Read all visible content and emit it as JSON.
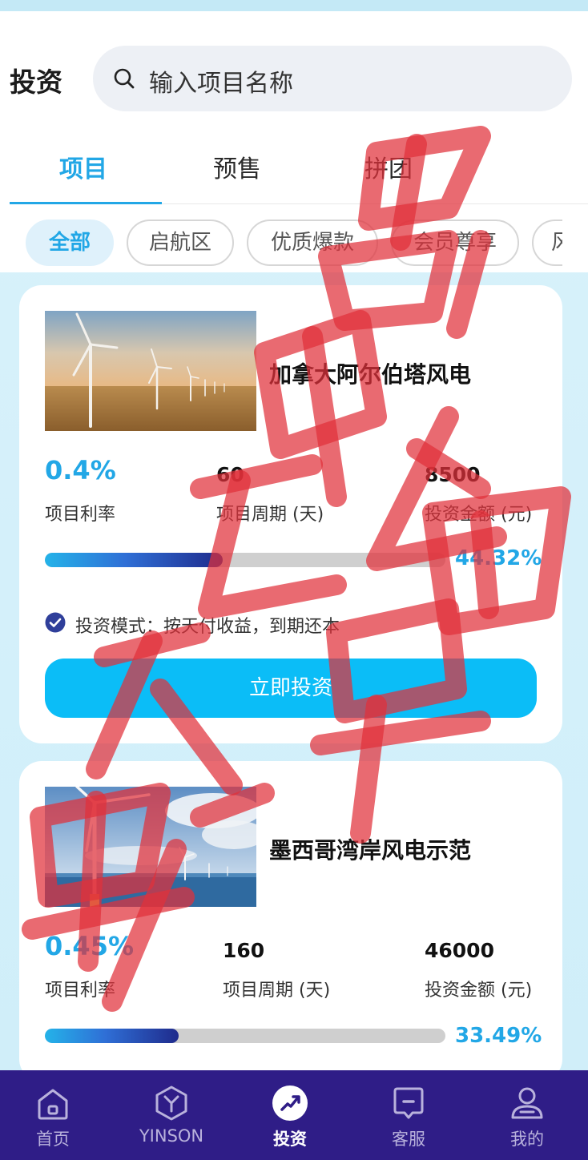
{
  "header": {
    "title": "投资",
    "search": {
      "placeholder": "输入项目名称"
    }
  },
  "tabs": [
    {
      "label": "项目",
      "active": true
    },
    {
      "label": "预售",
      "active": false
    },
    {
      "label": "拼团",
      "active": false
    }
  ],
  "filter_chips": [
    {
      "label": "全部",
      "active": true
    },
    {
      "label": "启航区",
      "active": false
    },
    {
      "label": "优质爆款",
      "active": false
    },
    {
      "label": "会员尊享",
      "active": false
    },
    {
      "label": "风",
      "active": false
    }
  ],
  "projects": [
    {
      "name": "加拿大阿尔伯塔风电",
      "image": "wind-turbines-prairie",
      "rate": "0.4%",
      "rate_label": "项目利率",
      "period": "60",
      "period_label": "项目周期 (天)",
      "amount": "8500",
      "amount_label": "投资金额 (元)",
      "progress_text": "44.32%",
      "progress": 0.4432,
      "mode": "投资模式：按天付收益，到期还本",
      "button": "立即投资"
    },
    {
      "name": "墨西哥湾岸风电示范",
      "image": "offshore-wind-turbines",
      "rate": "0.45%",
      "rate_label": "项目利率",
      "period": "160",
      "period_label": "项目周期 (天)",
      "amount": "46000",
      "amount_label": "投资金额 (元)",
      "progress_text": "33.49%",
      "progress": 0.3349
    }
  ],
  "nav": [
    {
      "label": "首页",
      "icon": "home-icon",
      "active": false
    },
    {
      "label": "YINSON",
      "icon": "yinson-logo-icon",
      "active": false
    },
    {
      "label": "投资",
      "icon": "invest-icon",
      "active": true
    },
    {
      "label": "客服",
      "icon": "customer-service-icon",
      "active": false
    },
    {
      "label": "我的",
      "icon": "profile-icon",
      "active": false
    }
  ],
  "watermark": {
    "text": "骗子黑平台别投",
    "color": "#e0303a"
  },
  "colors": {
    "accent": "#22a7e6",
    "nav_bg": "#2f1d87",
    "button": "#0bbdf7"
  }
}
